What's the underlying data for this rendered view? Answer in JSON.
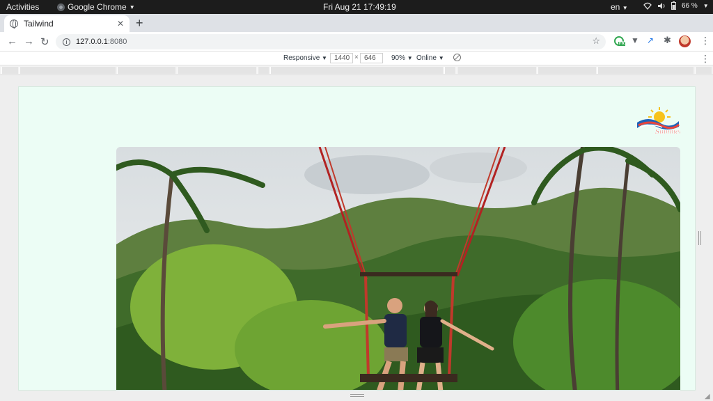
{
  "system_bar": {
    "activities": "Activities",
    "app_name": "Google Chrome",
    "clock": "Fri Aug 21  17:49:19",
    "language": "en",
    "battery": "66 %"
  },
  "browser": {
    "tab_title": "Tailwind",
    "url_host": "127.0.0.1",
    "url_port": ":8080",
    "extension_badge": "FR"
  },
  "device_toolbar": {
    "mode": "Responsive",
    "width": "1440",
    "height": "646",
    "zoom": "90%",
    "network": "Online"
  },
  "page": {
    "logo_text": "Summer",
    "background_color": "#ecfdf5",
    "hero_image": "couple-on-jungle-swing"
  }
}
